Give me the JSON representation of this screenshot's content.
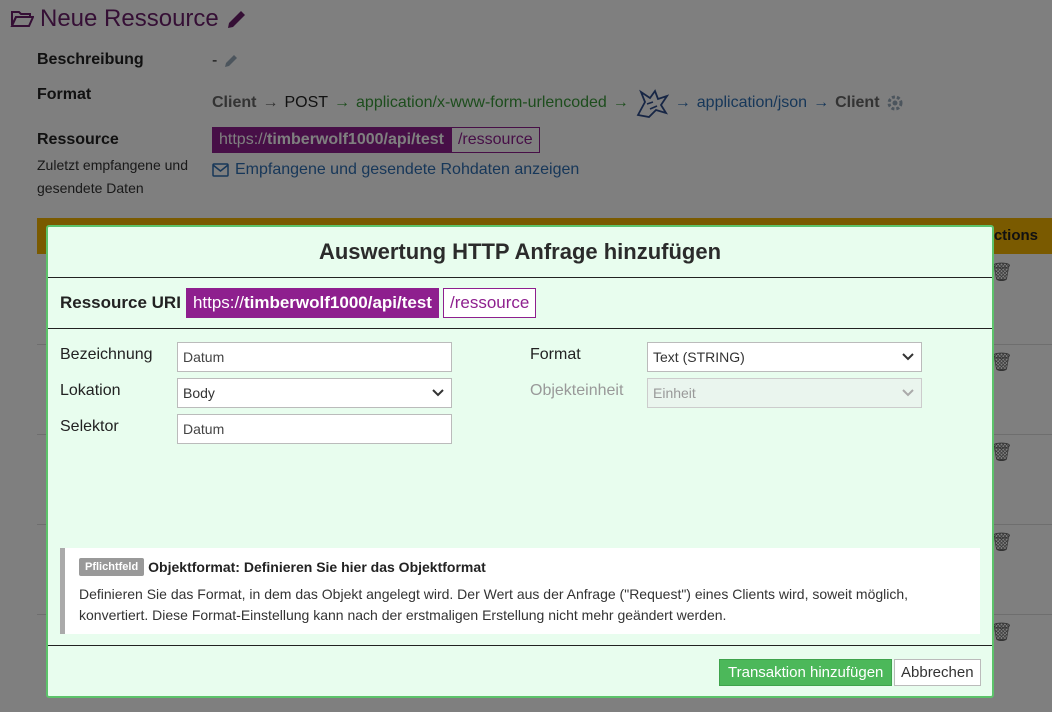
{
  "page": {
    "title": "Neue Ressource",
    "labels": {
      "description": "Beschreibung",
      "format": "Format",
      "resource": "Ressource",
      "resource_sub": "Zuletzt empfangene und gesendete Daten"
    },
    "description_value": "-",
    "format_flow": {
      "client_in": "Client",
      "method": "POST",
      "request_type": "application/x-www-form-urlencoded",
      "response_type": "application/json",
      "client_out": "Client"
    },
    "resource_uri": {
      "base": "timberwolf1000/api/test",
      "scheme": "https://",
      "path": "/ressource"
    },
    "raw_data_link": "Empfangene und gesendete Rohdaten anzeigen",
    "table_header_partial": "ctions"
  },
  "modal": {
    "title": "Auswertung HTTP Anfrage hinzufügen",
    "uri_label": "Ressource URI",
    "uri": {
      "scheme": "https://",
      "base": "timberwolf1000/api/test",
      "path": "/ressource"
    },
    "fields": {
      "name_label": "Bezeichnung",
      "name_value": "Datum",
      "location_label": "Lokation",
      "location_value": "Body",
      "selector_label": "Selektor",
      "selector_value": "Datum",
      "format_label": "Format",
      "format_value": "Text (STRING)",
      "unit_label": "Objekteinheit",
      "unit_value": "Einheit"
    },
    "note": {
      "badge": "Pflichtfeld",
      "title": "Objektformat: Definieren Sie hier das Objektformat",
      "body": "Definieren Sie das Format, in dem das Objekt angelegt wird. Der Wert aus der Anfrage (\"Request\") eines Clients wird, soweit möglich, konvertiert. Diese Format-Einstellung kann nach der erstmaligen Erstellung nicht mehr geändert werden."
    },
    "buttons": {
      "submit": "Transaktion hinzufügen",
      "cancel": "Abbrechen"
    }
  },
  "colors": {
    "brand": "#8e1f8e",
    "accent": "#f4b400",
    "modal_bg": "#e8fdee",
    "primary": "#4cb85a",
    "link": "#2f6fb3",
    "green_text": "#3a9a3a"
  }
}
